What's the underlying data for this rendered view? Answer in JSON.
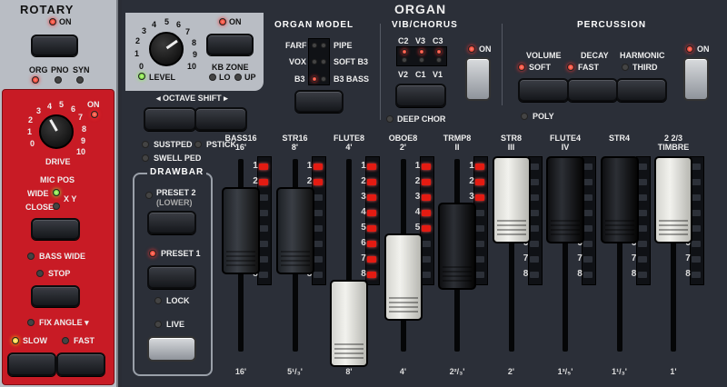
{
  "rotary": {
    "title": "ROTARY",
    "on_label": "ON",
    "type_options": [
      "ORG",
      "PNO",
      "SYN"
    ],
    "drive_label": "DRIVE",
    "drive_scale": [
      "0",
      "1",
      "2",
      "3",
      "4",
      "5",
      "6",
      "7",
      "8",
      "9",
      "10"
    ],
    "drive_on_label": "ON",
    "mic_pos_label": "MIC POS",
    "wide_label": "WIDE",
    "xy_label": "X Y",
    "close_label": "CLOSE",
    "bass_wide_label": "BASS WIDE",
    "stop_label": "STOP",
    "fix_angle_label": "FIX ANGLE ▾",
    "slow_label": "SLOW",
    "fast_label": "FAST"
  },
  "organ": {
    "title": "ORGAN",
    "level_label": "LEVEL",
    "level_scale": [
      "0",
      "1",
      "2",
      "3",
      "4",
      "5",
      "6",
      "7",
      "8",
      "9",
      "10"
    ],
    "on_label": "ON",
    "kb_zone_label": "KB ZONE",
    "kb_zone_lo": "LO",
    "kb_zone_up": "UP",
    "octave_shift_label": "◂ OCTAVE SHIFT ▸",
    "sustped_label": "SUSTPED",
    "pstick_label": "PSTICK",
    "swell_ped_label": "SWELL PED",
    "drawbar_title": "DRAWBAR",
    "preset2_label": "PRESET 2",
    "preset2_sub": "(LOWER)",
    "preset1_label": "PRESET 1",
    "lock_label": "LOCK",
    "live_label": "LIVE"
  },
  "organ_model": {
    "title": "ORGAN MODEL",
    "left_labels": [
      "FARF",
      "VOX",
      "B3"
    ],
    "right_labels": [
      "PIPE",
      "SOFT B3",
      "B3 BASS"
    ]
  },
  "vib_chorus": {
    "title": "VIB/CHORUS",
    "top_labels": [
      "C2",
      "V3",
      "C3"
    ],
    "bottom_labels": [
      "V2",
      "C1",
      "V1"
    ],
    "deep_chor_label": "DEEP CHOR",
    "on_label": "ON"
  },
  "percussion": {
    "title": "PERCUSSION",
    "volume_label": "VOLUME",
    "soft_label": "SOFT",
    "decay_label": "DECAY",
    "fast_label": "FAST",
    "harmonic_label": "HARMONIC",
    "third_label": "THIRD",
    "poly_label": "POLY",
    "on_label": "ON"
  },
  "drawbars": [
    {
      "name": "BASS16",
      "sub": "16'",
      "foot": "16'",
      "color": "dark",
      "level": 2
    },
    {
      "name": "STR16",
      "sub": "8'",
      "foot": "5¹/₃'",
      "color": "dark",
      "level": 2
    },
    {
      "name": "FLUTE8",
      "sub": "4'",
      "foot": "8'",
      "color": "white",
      "level": 8
    },
    {
      "name": "OBOE8",
      "sub": "2'",
      "foot": "4'",
      "color": "white",
      "level": 5
    },
    {
      "name": "TRMP8",
      "sub": "II",
      "foot": "2²/₃'",
      "color": "black",
      "level": 3
    },
    {
      "name": "STR8",
      "sub": "III",
      "foot": "2'",
      "color": "white",
      "level": 0
    },
    {
      "name": "FLUTE4",
      "sub": "IV",
      "foot": "1³/₅'",
      "color": "black",
      "level": 0
    },
    {
      "name": "STR4",
      "sub": "",
      "foot": "1¹/₃'",
      "color": "black",
      "level": 0
    },
    {
      "name": "2 2/3",
      "sub": "TIMBRE",
      "foot": "1'",
      "color": "white",
      "level": 0
    }
  ],
  "drawbar_scale": [
    "1",
    "2",
    "3",
    "4",
    "5",
    "6",
    "7",
    "8"
  ],
  "colors": {
    "rotary_red": "#c81b25",
    "organ_bg": "#2b2f38",
    "led_red": "#e41b12",
    "led_green": "#4ec420"
  }
}
